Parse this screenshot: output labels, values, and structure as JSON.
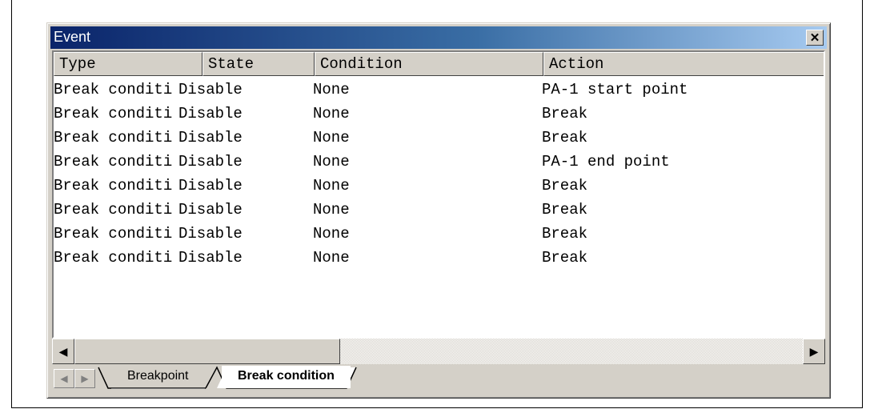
{
  "window": {
    "title": "Event"
  },
  "columns": [
    "Type",
    "State",
    "Condition",
    "Action"
  ],
  "rows": [
    {
      "type": "Break conditi",
      "state": "Disable",
      "condition": "None",
      "action": "PA-1 start point"
    },
    {
      "type": "Break conditi",
      "state": "Disable",
      "condition": "None",
      "action": "Break"
    },
    {
      "type": "Break conditi",
      "state": "Disable",
      "condition": "None",
      "action": "Break"
    },
    {
      "type": "Break conditi",
      "state": "Disable",
      "condition": "None",
      "action": "PA-1 end point"
    },
    {
      "type": "Break conditi",
      "state": "Disable",
      "condition": "None",
      "action": "Break"
    },
    {
      "type": "Break conditi",
      "state": "Disable",
      "condition": "None",
      "action": "Break"
    },
    {
      "type": "Break conditi",
      "state": "Disable",
      "condition": "None",
      "action": "Break"
    },
    {
      "type": "Break conditi",
      "state": "Disable",
      "condition": "None",
      "action": "Break"
    }
  ],
  "tabs": [
    {
      "label": "Breakpoint",
      "active": false
    },
    {
      "label": "Break condition",
      "active": true
    }
  ],
  "icons": {
    "close": "close-icon",
    "scroll_left": "arrow-left-icon",
    "scroll_right": "arrow-right-icon",
    "tab_prev": "triangle-left-icon",
    "tab_next": "triangle-right-icon"
  },
  "colors": {
    "titlebar_start": "#0a246a",
    "titlebar_end": "#a6caf0",
    "chrome": "#d4d0c8",
    "list_bg": "#ffffff"
  }
}
